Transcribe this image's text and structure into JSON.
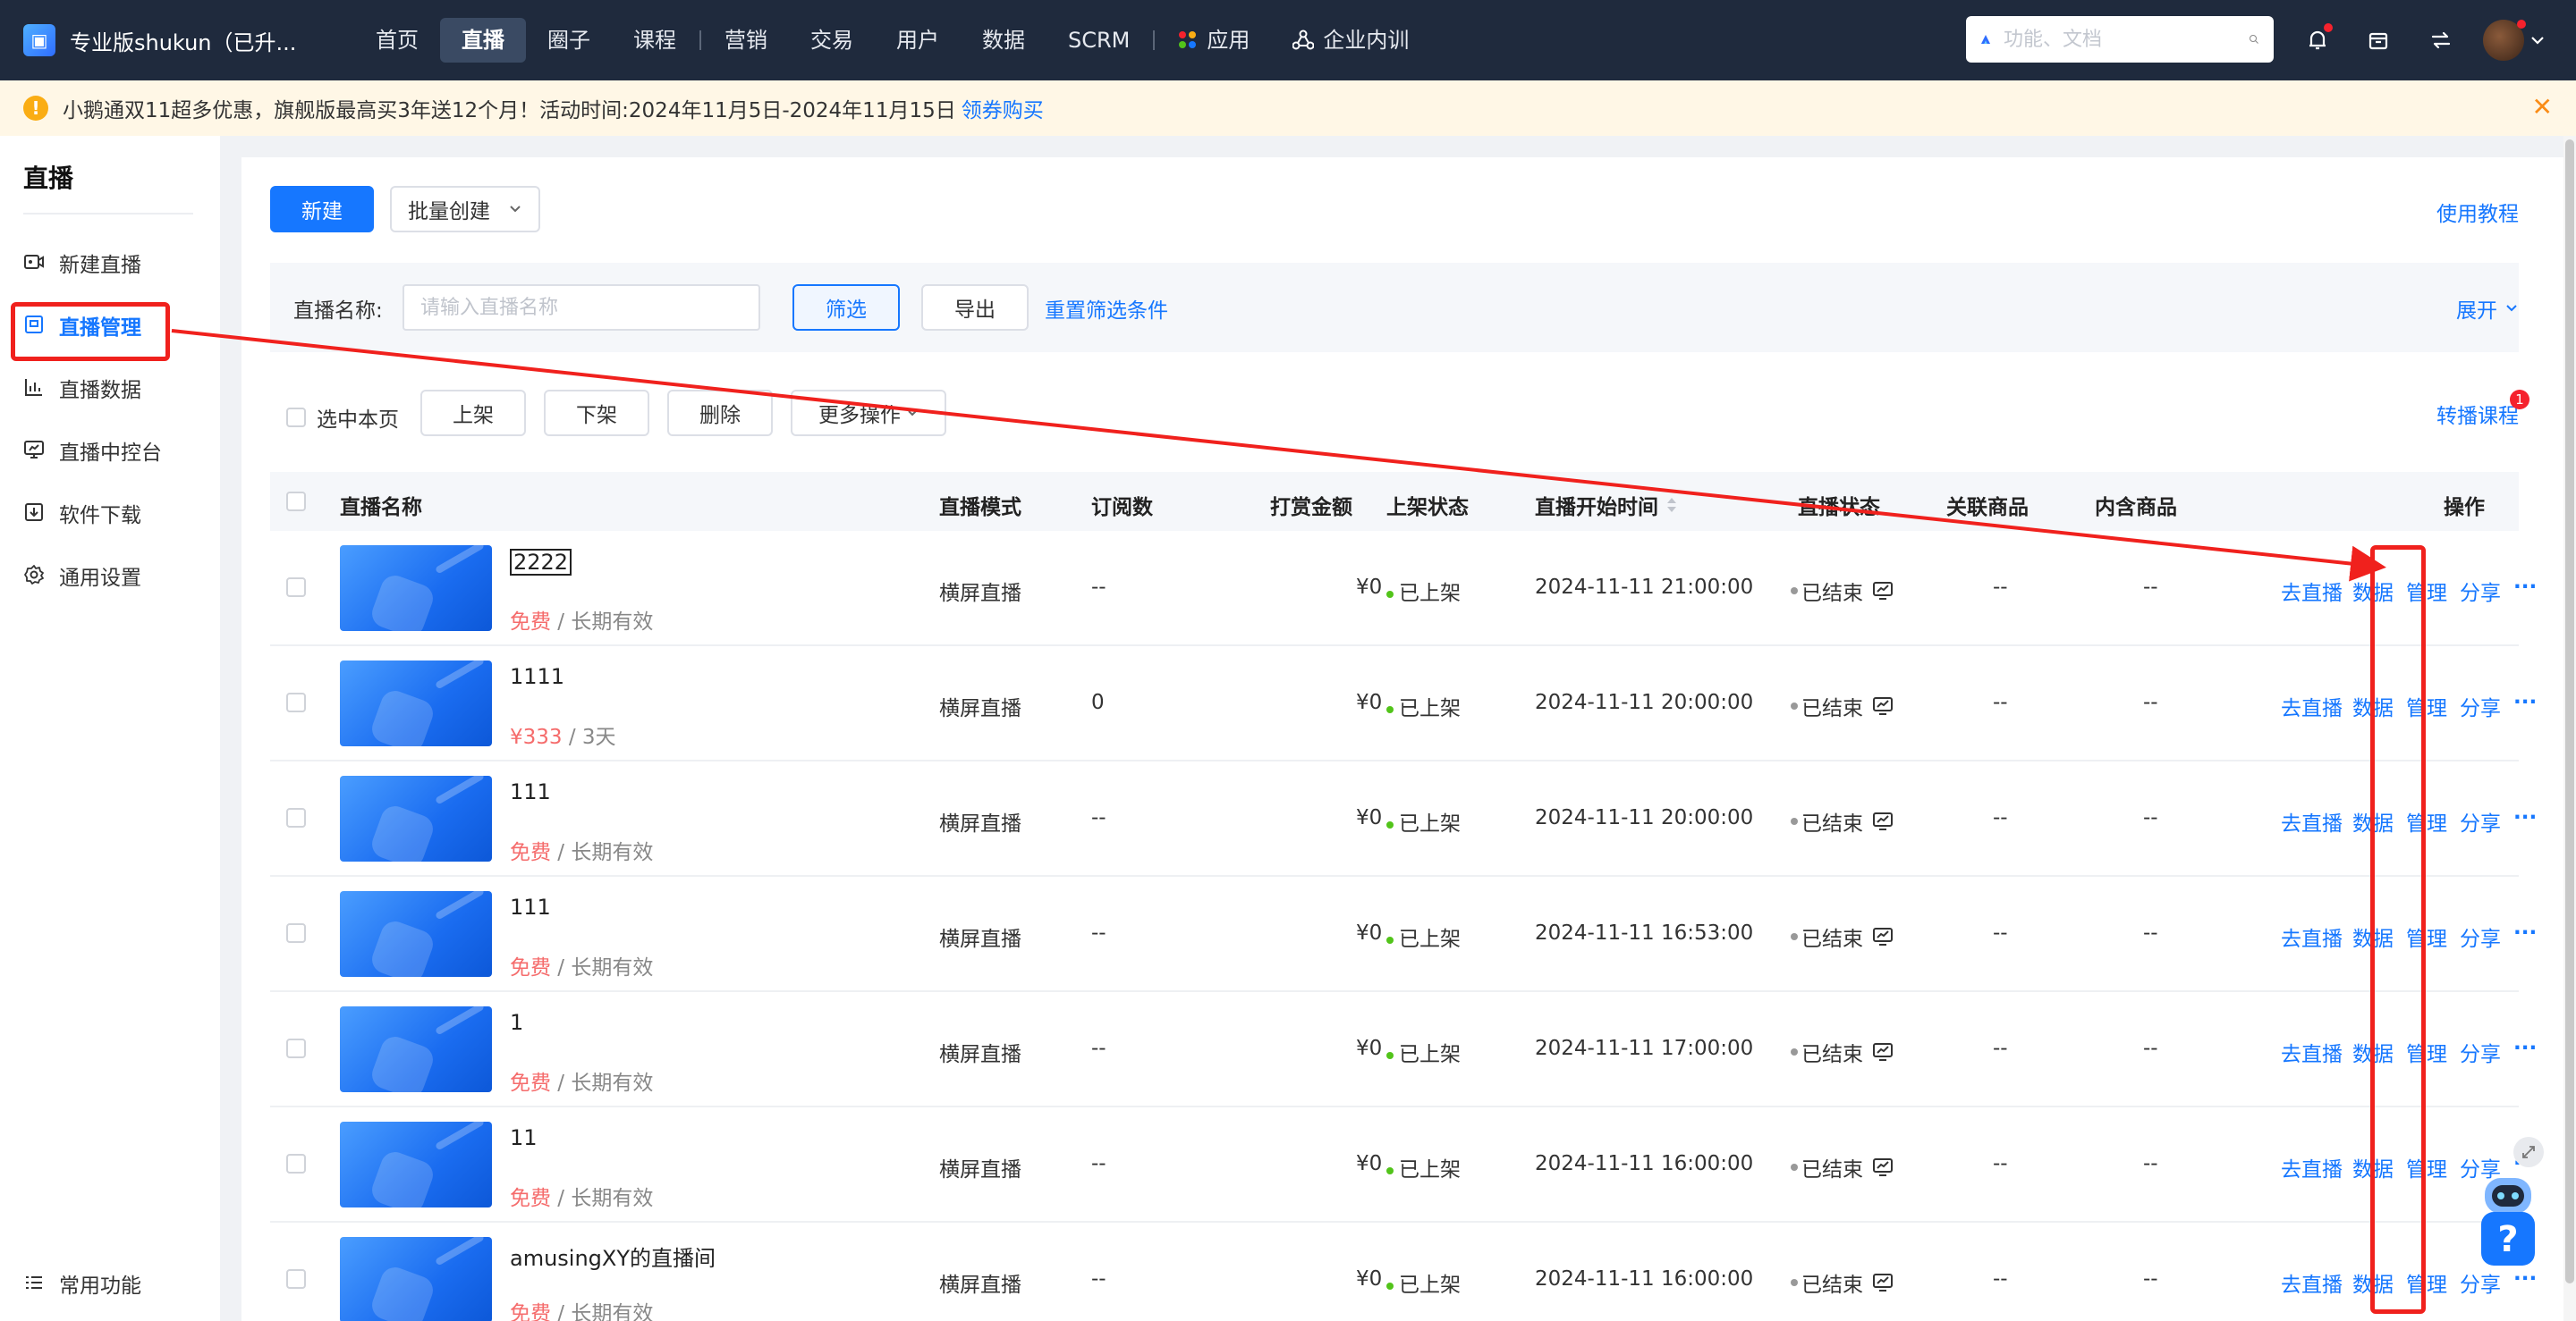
{
  "topbar": {
    "brand": "专业版shukun（已升...",
    "nav": [
      {
        "label": "首页",
        "active": false
      },
      {
        "label": "直播",
        "active": true
      },
      {
        "label": "圈子",
        "active": false
      },
      {
        "label": "课程",
        "active": false
      },
      {
        "label": "营销",
        "active": false
      },
      {
        "label": "交易",
        "active": false
      },
      {
        "label": "用户",
        "active": false
      },
      {
        "label": "数据",
        "active": false
      },
      {
        "label": "SCRM",
        "active": false
      },
      {
        "label": "应用",
        "active": false
      },
      {
        "label": "企业内训",
        "active": false
      }
    ],
    "search_placeholder": "功能、文档"
  },
  "notice": {
    "text": "小鹅通双11超多优惠，旗舰版最高买3年送12个月！活动时间:2024年11月5日-2024年11月15日",
    "link": "领券购买"
  },
  "sidebar": {
    "title": "直播",
    "items": [
      {
        "label": "新建直播",
        "icon": "video-add-icon"
      },
      {
        "label": "直播管理",
        "icon": "live-manage-icon",
        "active": true
      },
      {
        "label": "直播数据",
        "icon": "chart-icon"
      },
      {
        "label": "直播中控台",
        "icon": "monitor-icon"
      },
      {
        "label": "软件下载",
        "icon": "download-icon"
      },
      {
        "label": "通用设置",
        "icon": "gear-icon"
      }
    ],
    "bottom": "常用功能"
  },
  "toolbar": {
    "new_label": "新建",
    "batch_label": "批量创建",
    "tutorial": "使用教程"
  },
  "filter": {
    "label": "直播名称:",
    "placeholder": "请输入直播名称",
    "filter_btn": "筛选",
    "export_btn": "导出",
    "reset": "重置筛选条件",
    "expand": "展开"
  },
  "bulk": {
    "select_page": "选中本页",
    "on": "上架",
    "off": "下架",
    "delete": "删除",
    "more": "更多操作",
    "transfer": "转播课程",
    "transfer_badge": "1"
  },
  "table": {
    "headers": [
      "直播名称",
      "直播模式",
      "订阅数",
      "打赏金额",
      "上架状态",
      "直播开始时间",
      "直播状态",
      "关联商品",
      "内含商品",
      "操作"
    ],
    "actions": [
      "去直播",
      "数据",
      "管理",
      "分享",
      "···"
    ],
    "rows": [
      {
        "name": "2222",
        "price": "免费",
        "validity": "长期有效",
        "mode": "横屏直播",
        "subs": "--",
        "reward": "¥0",
        "shelf": "已上架",
        "start": "2024-11-11 21:00:00",
        "status": "已结束",
        "related": "--",
        "included": "--"
      },
      {
        "name": "1111",
        "price": "¥333",
        "validity": "3天",
        "mode": "横屏直播",
        "subs": "0",
        "reward": "¥0",
        "shelf": "已上架",
        "start": "2024-11-11 20:00:00",
        "status": "已结束",
        "related": "--",
        "included": "--"
      },
      {
        "name": "111",
        "price": "免费",
        "validity": "长期有效",
        "mode": "横屏直播",
        "subs": "--",
        "reward": "¥0",
        "shelf": "已上架",
        "start": "2024-11-11 20:00:00",
        "status": "已结束",
        "related": "--",
        "included": "--"
      },
      {
        "name": "111",
        "price": "免费",
        "validity": "长期有效",
        "mode": "横屏直播",
        "subs": "--",
        "reward": "¥0",
        "shelf": "已上架",
        "start": "2024-11-11 16:53:00",
        "status": "已结束",
        "related": "--",
        "included": "--"
      },
      {
        "name": "1",
        "price": "免费",
        "validity": "长期有效",
        "mode": "横屏直播",
        "subs": "--",
        "reward": "¥0",
        "shelf": "已上架",
        "start": "2024-11-11 17:00:00",
        "status": "已结束",
        "related": "--",
        "included": "--"
      },
      {
        "name": "11",
        "price": "免费",
        "validity": "长期有效",
        "mode": "横屏直播",
        "subs": "--",
        "reward": "¥0",
        "shelf": "已上架",
        "start": "2024-11-11 16:00:00",
        "status": "已结束",
        "related": "--",
        "included": "--"
      },
      {
        "name": "amusingXY的直播间",
        "price": "免费",
        "validity": "长期有效",
        "mode": "横屏直播",
        "subs": "--",
        "reward": "¥0",
        "shelf": "已上架",
        "start": "2024-11-11 16:00:00",
        "status": "已结束",
        "related": "--",
        "included": "--"
      }
    ]
  },
  "colors": {
    "accent": "#1677ff",
    "annotation_red": "#f0211d"
  }
}
